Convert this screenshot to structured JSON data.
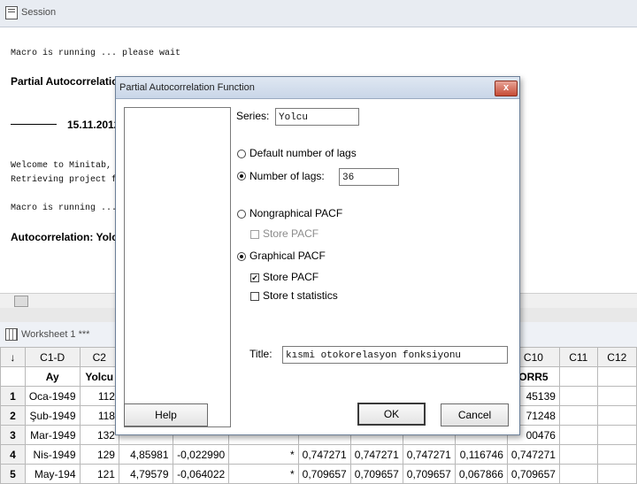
{
  "session": {
    "title": "Session",
    "lines": {
      "macro1": "Macro is running ... please wait",
      "heading1": "Partial Autocorrelation",
      "date": "15.11.2012",
      "welcome": "Welcome to Minitab, p",
      "retrieving": "Retrieving project fro",
      "macro2": "Macro is running ... p",
      "heading2": "Autocorrelation: Yolcu"
    }
  },
  "worksheet": {
    "title": "Worksheet 1 ***",
    "corner": "↓",
    "col_ids": [
      "C1-D",
      "C2",
      "",
      "",
      "",
      "",
      "",
      "",
      "",
      "C10",
      "C11",
      "C12"
    ],
    "col_names": [
      "Ay",
      "Yolcu",
      "",
      "",
      "",
      "",
      "",
      "",
      "",
      "ORR5",
      "",
      ""
    ],
    "rows": [
      {
        "n": "1",
        "cells": [
          "Oca-1949",
          "112",
          "",
          "",
          "",
          "",
          "",
          "",
          "",
          "45139",
          "",
          ""
        ]
      },
      {
        "n": "2",
        "cells": [
          "Şub-1949",
          "118",
          "",
          "",
          "",
          "",
          "",
          "",
          "",
          "71248",
          "",
          ""
        ]
      },
      {
        "n": "3",
        "cells": [
          "Mar-1949",
          "132",
          "",
          "",
          "",
          "",
          "",
          "",
          "",
          "00476",
          "",
          ""
        ]
      },
      {
        "n": "4",
        "cells": [
          "Nis-1949",
          "129",
          "4,85981",
          "-0,022990",
          "*",
          "0,747271",
          "0,747271",
          "0,747271",
          "0,116746",
          "0,747271",
          "",
          ""
        ]
      },
      {
        "n": "5",
        "cells": [
          "May-194",
          "121",
          "4,79579",
          "-0,064022",
          "*",
          "0,709657",
          "0,709657",
          "0,709657",
          "0,067866",
          "0,709657",
          "",
          ""
        ]
      }
    ]
  },
  "dialog": {
    "title": "Partial Autocorrelation Function",
    "close_label": "x",
    "series_label": "Series:",
    "series_value": "Yolcu",
    "default_lags_label": "Default number of lags",
    "number_lags_label": "Number of lags:",
    "number_lags_value": "36",
    "nongraphical_label": "Nongraphical PACF",
    "store_pacf_disabled_label": "Store PACF",
    "graphical_label": "Graphical PACF",
    "store_pacf_label": "Store PACF",
    "store_t_label": "Store t statistics",
    "title_label": "Title:",
    "title_value": "kısmi otokorelasyon fonksiyonu",
    "help_label": "Help",
    "ok_label": "OK",
    "cancel_label": "Cancel",
    "check_glyph": "✔"
  }
}
